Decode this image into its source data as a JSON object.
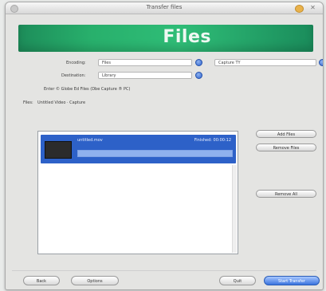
{
  "window": {
    "title": "Transfer files"
  },
  "banner": {
    "title": "Files"
  },
  "form": {
    "encoding_label": "Encoding:",
    "encoding_value": "Files",
    "destination_label": "Destination:",
    "destination_value": "Library",
    "hint": "Enter © Globe Ed Files (Dbe Capture ® PC)",
    "target_select_value": "Capture TY",
    "file_row_label": "Files:",
    "file_row_value": "Untitled Video · Capture"
  },
  "list": {
    "item_name": "untitled.mov",
    "item_status": "Finished: 00:00:12",
    "progress": 1.0
  },
  "side_buttons": {
    "add_files": "Add Files",
    "remove_files": "Remove Files",
    "remove_all": "Remove All"
  },
  "bottom_buttons": {
    "back": "Back",
    "options": "Options",
    "quit": "Quit",
    "start": "Start Transfer"
  },
  "colors": {
    "banner_green": "#1d8d5a",
    "selection_blue": "#2d61c8",
    "primary_blue": "#3a74de"
  }
}
